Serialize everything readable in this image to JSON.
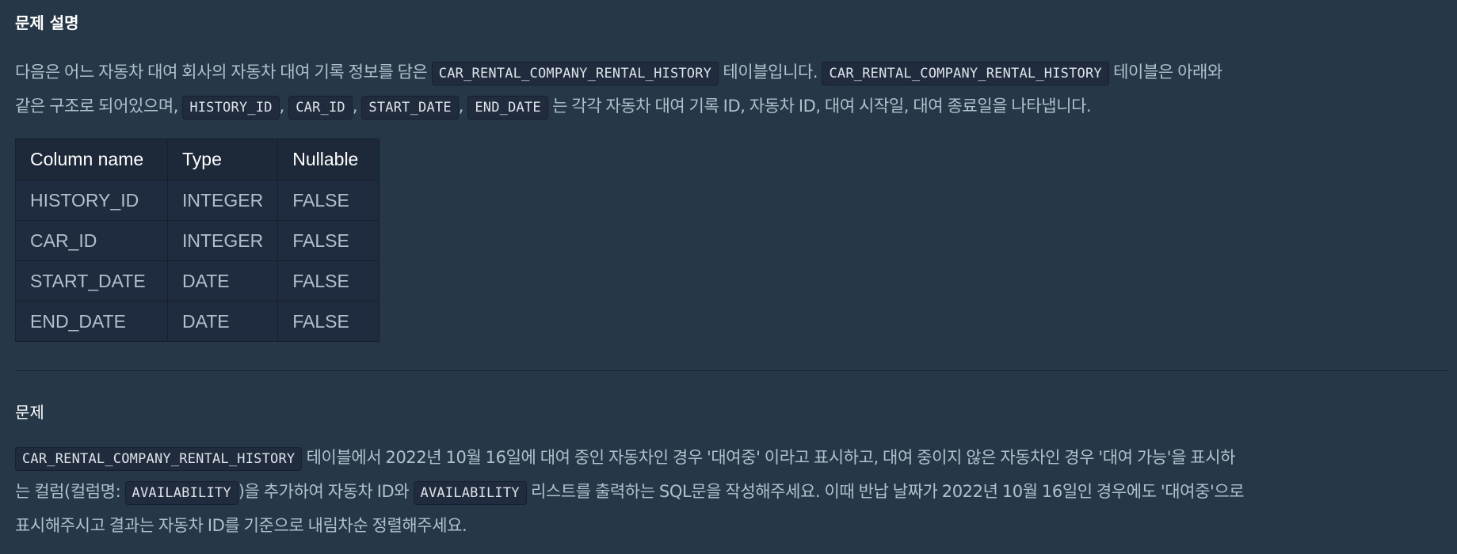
{
  "section_description": {
    "title": "문제 설명",
    "p1": {
      "l1_a": "다음은 어느 자동차 대여 회사의 자동차 대여 기록 정보를 담은",
      "l1_code1": "CAR_RENTAL_COMPANY_RENTAL_HISTORY",
      "l1_b": "테이블입니다.",
      "l1_code2": "CAR_RENTAL_COMPANY_RENTAL_HISTORY",
      "l1_c": "테이블은 아래와",
      "l2_a": "같은 구조로 되어있으며,",
      "l2_code1": "HISTORY_ID",
      "comma1": ",",
      "l2_code2": "CAR_ID",
      "comma2": ",",
      "l2_code3": "START_DATE",
      "comma3": ",",
      "l2_code4": "END_DATE",
      "l2_b": "는 각각 자동차 대여 기록 ID, 자동차 ID, 대여 시작일, 대여 종료일을 나타냅니다."
    },
    "table": {
      "headers": [
        "Column name",
        "Type",
        "Nullable"
      ],
      "rows": [
        [
          "HISTORY_ID",
          "INTEGER",
          "FALSE"
        ],
        [
          "CAR_ID",
          "INTEGER",
          "FALSE"
        ],
        [
          "START_DATE",
          "DATE",
          "FALSE"
        ],
        [
          "END_DATE",
          "DATE",
          "FALSE"
        ]
      ]
    }
  },
  "section_problem": {
    "title": "문제",
    "p1": {
      "l1_code1": "CAR_RENTAL_COMPANY_RENTAL_HISTORY",
      "l1_a": "테이블에서 2022년 10월 16일에 대여 중인 자동차인 경우 '대여중' 이라고 표시하고, 대여 중이지 않은 자동차인 경우 '대여 가능'을 표시하",
      "l2_a": "는 컬럼(컬럼명:",
      "l2_code1": "AVAILABILITY",
      "l2_b": ")을 추가하여 자동차 ID와",
      "l2_code2": "AVAILABILITY",
      "l2_c": "리스트를 출력하는 SQL문을 작성해주세요. 이때 반납 날짜가 2022년 10월 16일인 경우에도 '대여중'으로",
      "l3_a": "표시해주시고 결과는 자동차 ID를 기준으로 내림차순 정렬해주세요."
    }
  },
  "colors": {
    "background": "#263747",
    "text": "#b2c0cc",
    "heading": "#ffffff",
    "code_bg": "#202b3d",
    "table_bg": "#1f2b3e"
  }
}
